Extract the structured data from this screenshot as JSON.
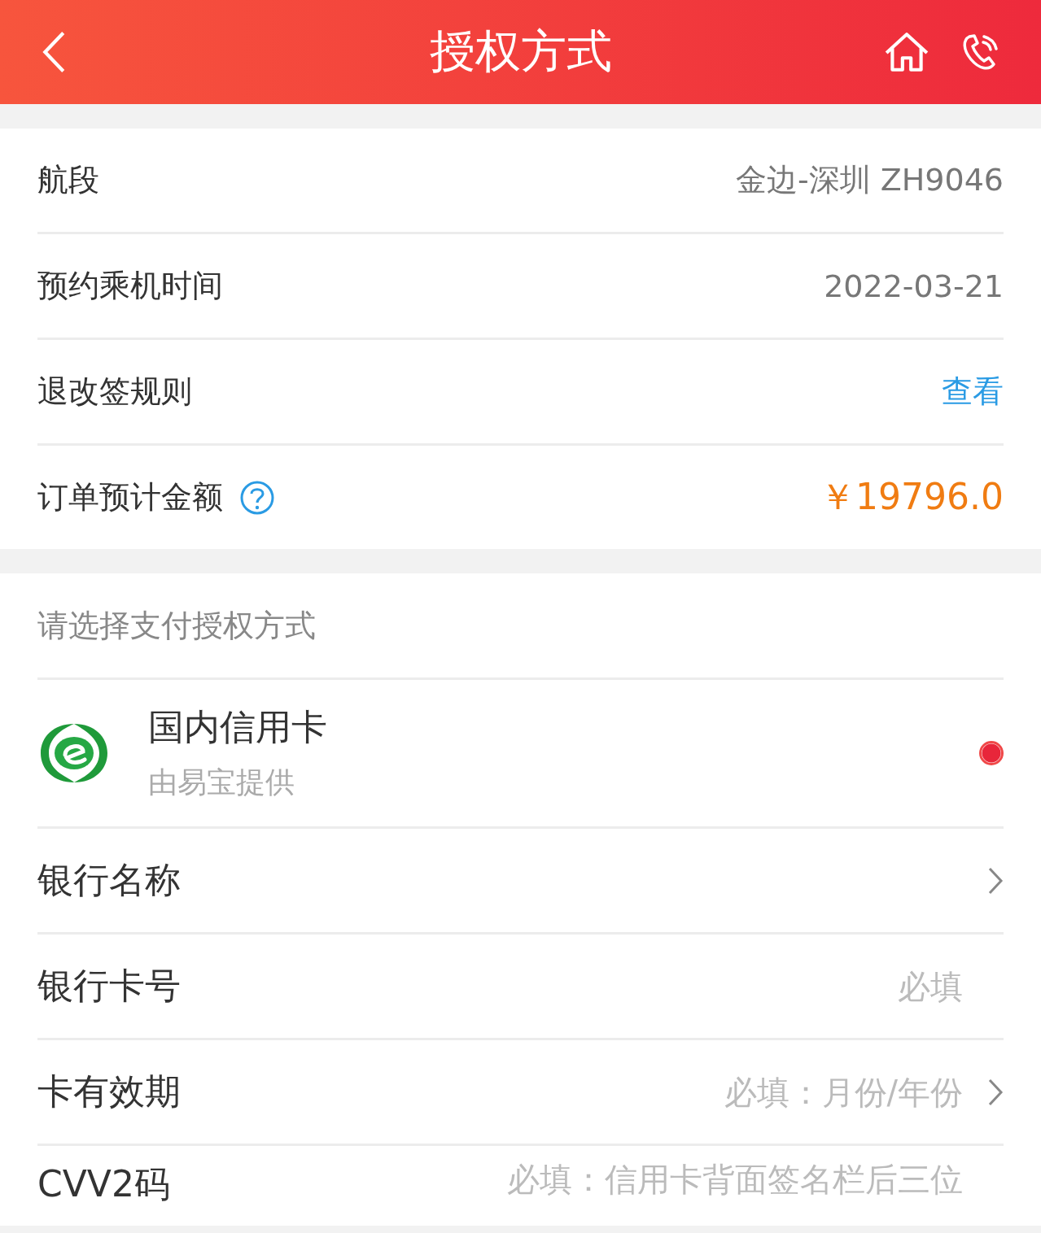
{
  "header": {
    "title": "授权方式"
  },
  "info_rows": [
    {
      "label": "航段",
      "value": "金边-深圳 ZH9046",
      "kind": "text"
    },
    {
      "label": "预约乘机时间",
      "value": "2022-03-21",
      "kind": "text"
    },
    {
      "label": "退改签规则",
      "value": "查看",
      "kind": "link"
    },
    {
      "label": "订单预计金额",
      "value": "￥19796.0",
      "kind": "amount",
      "help": true
    }
  ],
  "payment": {
    "heading": "请选择支付授权方式",
    "methods": [
      {
        "name": "国内信用卡",
        "provider": "由易宝提供",
        "selected": true
      }
    ]
  },
  "form_fields": [
    {
      "label": "银行名称",
      "kind": "select"
    },
    {
      "label": "银行卡号",
      "placeholder": "必填",
      "kind": "input"
    },
    {
      "label": "卡有效期",
      "placeholder": "必填：月份/年份",
      "kind": "select"
    },
    {
      "label": "CVV2码",
      "placeholder": "必填：信用卡背面签名栏后三位",
      "kind": "input"
    }
  ]
}
